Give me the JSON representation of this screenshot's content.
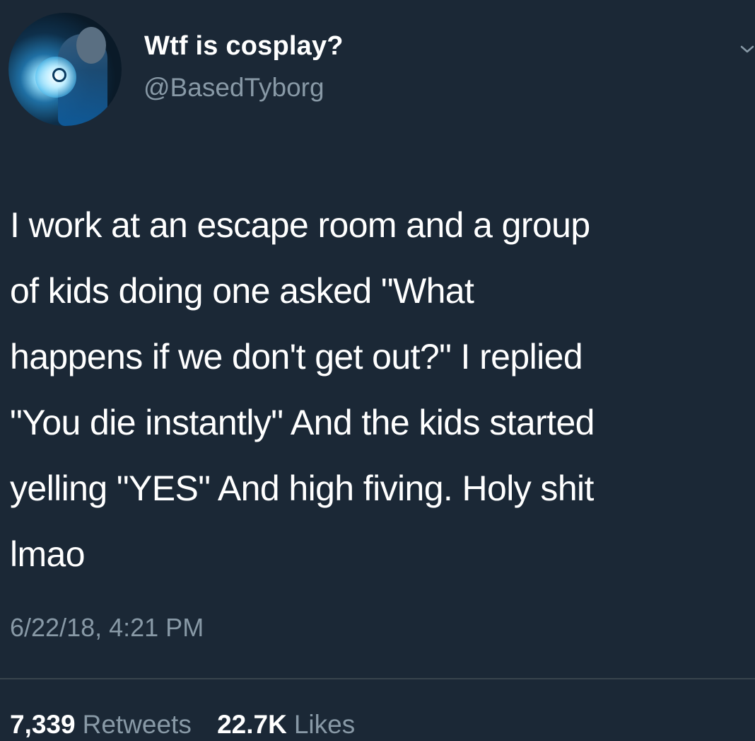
{
  "tweet": {
    "display_name": "Wtf is cosplay?",
    "handle": "@BasedTyborg",
    "text_lines": [
      "I work at an escape room and a group",
      "of kids doing one asked \"What",
      "happens if we don't get out?\" I replied",
      "\"You die instantly\" And the kids started",
      "yelling \"YES\" And high fiving. Holy shit",
      "lmao"
    ],
    "timestamp": "6/22/18, 4:21 PM",
    "stats": {
      "retweets_count": "7,339",
      "retweets_label": "Retweets",
      "likes_count": "22.7K",
      "likes_label": "Likes"
    }
  },
  "icons": {
    "menu": "chevron-down-icon",
    "avatar": "profile-avatar"
  },
  "colors": {
    "background": "#1b2836",
    "primary_text": "#ffffff",
    "secondary_text": "#8899a6",
    "divider": "#38444d"
  }
}
